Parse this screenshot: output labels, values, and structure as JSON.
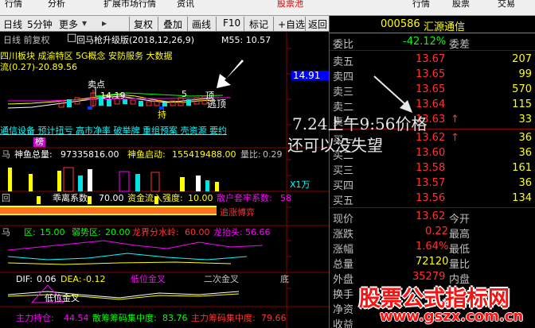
{
  "menu": {
    "items": [
      "行情",
      "分析",
      "扩展市场行情",
      "资讯",
      "股票池"
    ],
    "right_items": [
      "行情",
      "股票",
      "交易"
    ]
  },
  "toolbar": {
    "period_day": "日线",
    "period_5min": "5分钟",
    "more": "更多",
    "buttons": [
      "复权",
      "叠加",
      "画线",
      "F10",
      "标记",
      "+自选",
      "返回"
    ]
  },
  "chart": {
    "header": {
      "title": "日线 前复权",
      "indicator": "回马枪升级版(2018,12,26,9)",
      "ma": "M55: 10.57"
    },
    "concept_line": "四川板块 成渝特区 5G概念 安防服务 大数据",
    "flow_line": "流(0.27)-20.89.56",
    "price_label": "14.91",
    "labels": {
      "sell_point": "卖点",
      "peak_price": "14.19",
      "escape": "逃顶",
      "top_label": "顶",
      "hold": "持",
      "num5": "5"
    },
    "news_line": "通信设备 预计扭亏 高市净率 破举牌 重组预案 壳资源 要约",
    "buy_mark": "榜",
    "volume": {
      "prefix": "马",
      "total_label": "神鱼总量:",
      "total": "97335816.00",
      "start_label": "神鱼启动:",
      "start": "155419488.00",
      "ratio_label": "量比:",
      "ratio": "0.29",
      "unit": "X1万"
    },
    "strength": {
      "prefix": "回",
      "divergence_label": "乖离系数:",
      "divergence": "70.00",
      "inflow_label": "资金流入强度:",
      "inflow": "10.00",
      "retail_label": "散户套牢系数:",
      "retail": "58"
    },
    "game_text": "追涨博弈",
    "zone": {
      "prefix": "马",
      "weak_label": "区:",
      "weak": "15.00",
      "weak2_label": "弱势区:",
      "weak2": "20.00",
      "dragon_label": "龙界分水岭:",
      "dragon": "60.00",
      "head_label": "龙抬头:",
      "head": "56.66"
    },
    "macd": {
      "dif_label": "DIF:",
      "dif": "0.06",
      "dea_label": "DEA:",
      "dea": "-0.12",
      "low_cross": "低位金叉",
      "second_cross": "二次金叉",
      "bottom": "底",
      "low_cross2": "低位金叉"
    },
    "bottom_bar": {
      "hold_label": "主力持仓:",
      "hold": "44.54",
      "chip_label": "散筹筹码集中度:",
      "chip": "83.76",
      "main_chip_label": "主力筹码集中度:",
      "main_chip": "79.66"
    }
  },
  "annotations": {
    "time_text": "7.24上午9:56价格",
    "comment": "还可以没失望"
  },
  "quote": {
    "code": "000586",
    "name": "汇源通信",
    "wei_bi_label": "委比",
    "wei_bi": "-42.12%",
    "wei_cha_label": "委差",
    "sell": [
      {
        "label": "卖五",
        "price": "13.67",
        "vol": "207"
      },
      {
        "label": "卖四",
        "price": "13.65",
        "vol": "99"
      },
      {
        "label": "卖三",
        "price": "13.65",
        "vol": "570"
      },
      {
        "label": "卖二",
        "price": "13.64",
        "vol": "115"
      },
      {
        "label": "卖一",
        "price": "13.63",
        "vol": "33",
        "arrow": "↑"
      }
    ],
    "buy": [
      {
        "label": "买一",
        "price": "13.62",
        "vol": "36",
        "arrow": "↑"
      },
      {
        "label": "买二",
        "price": "13.60",
        "vol": "36"
      },
      {
        "label": "买三",
        "price": "13.58",
        "vol": "161"
      },
      {
        "label": "买四",
        "price": "13.57",
        "vol": "36"
      },
      {
        "label": "买五",
        "price": "13.56",
        "vol": "134"
      }
    ],
    "stats": [
      {
        "label": "现价",
        "value": "13.62",
        "label2": "今开",
        "value2": ""
      },
      {
        "label": "涨跌",
        "value": "0.22",
        "label2": "最高",
        "value2": ""
      },
      {
        "label": "涨幅",
        "value": "1.64%",
        "label2": "最低",
        "value2": ""
      },
      {
        "label": "总量",
        "value": "72120",
        "label2": "量比",
        "value2": ""
      },
      {
        "label": "外盘",
        "value": "35279",
        "label2": "内盘",
        "value2": ""
      },
      {
        "label": "换手",
        "value": "",
        "label2": "",
        "value2": ""
      },
      {
        "label": "净资",
        "value": "",
        "label2": "",
        "value2": ""
      },
      {
        "label": "收益",
        "value": "",
        "label2": "",
        "value2": ""
      }
    ]
  },
  "watermark": {
    "title": "股票公式指标网",
    "url": "www.gszx.com.cn"
  },
  "colors": {
    "up": "#ff3232",
    "down": "#00e4e4",
    "yellow": "#ffff00",
    "cyan": "#00ffff",
    "magenta": "#ff00ff",
    "white": "#ffffff",
    "blue_bg": "#0000ff"
  }
}
